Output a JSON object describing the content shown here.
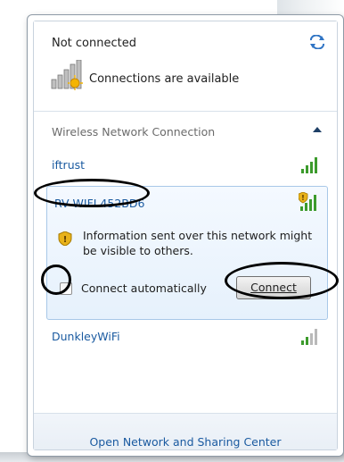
{
  "status": {
    "title": "Not connected",
    "connections_text": "Connections are available"
  },
  "wireless": {
    "section_label": "Wireless Network Connection",
    "networks": [
      {
        "name": "iftrust",
        "secured": false
      },
      {
        "name": "RV WIFI 452BD6",
        "secured": true,
        "selected": true
      },
      {
        "name": "DunkleyWiFi",
        "secured": false
      }
    ]
  },
  "selected_panel": {
    "warning_text": "Information sent over this network might be visible to others.",
    "auto_connect_label": "Connect automatically",
    "auto_connect_checked": false,
    "connect_button": "Connect"
  },
  "footer": {
    "link": "Open Network and Sharing Center"
  },
  "colors": {
    "link": "#1a5aa0",
    "signal_green": "#3c9b2c",
    "warning_yellow": "#e8b21a"
  }
}
